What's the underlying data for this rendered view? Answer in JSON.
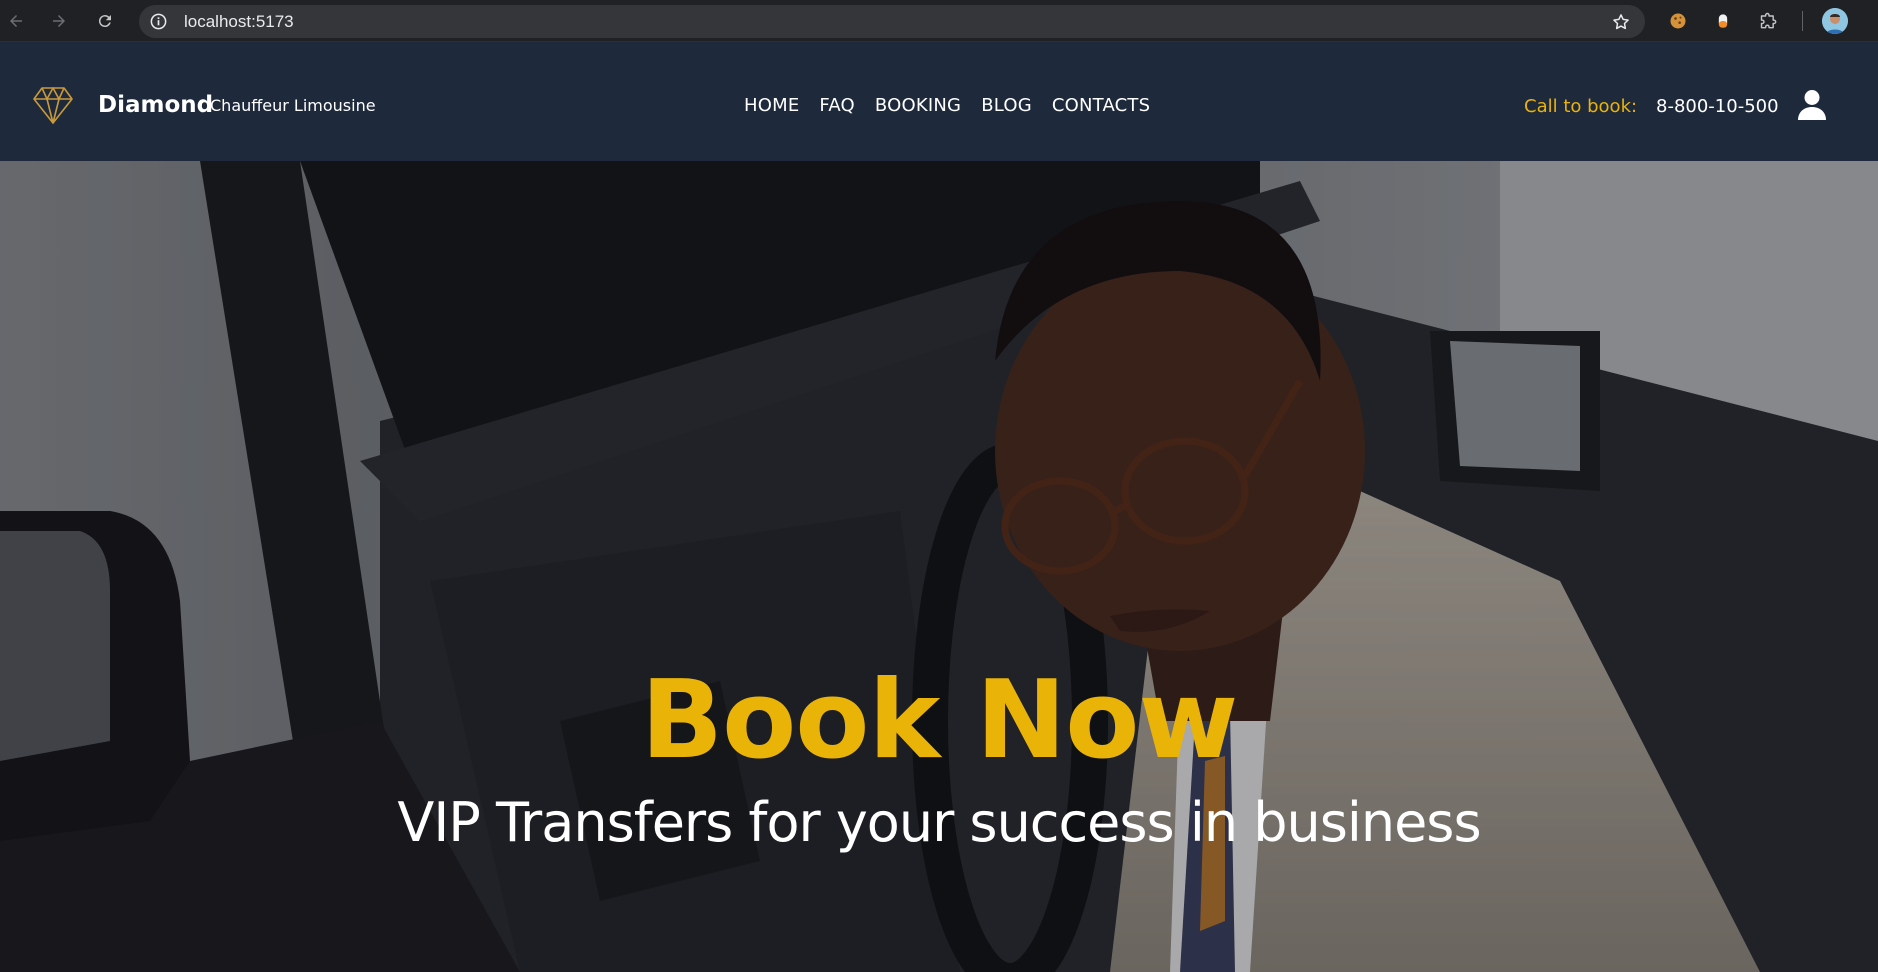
{
  "browser": {
    "url": "localhost:5173"
  },
  "site": {
    "brand": "Diamond",
    "brand_sub": "Chauffeur Limousine",
    "nav": [
      {
        "label": "HOME"
      },
      {
        "label": "FAQ"
      },
      {
        "label": "BOOKING"
      },
      {
        "label": "BLOG"
      },
      {
        "label": "CONTACTS"
      }
    ],
    "call_label": "Call to book:",
    "phone": "8-800-10-500"
  },
  "hero": {
    "title": "Book Now",
    "subtitle": "VIP Transfers for your success in business"
  },
  "colors": {
    "accent": "#eab308",
    "header_bg": "#1e293b",
    "browser_bg": "#202124"
  },
  "icons": {
    "logo": "diamond-icon",
    "user": "user-icon",
    "back": "arrow-left-icon",
    "forward": "arrow-right-icon",
    "reload": "reload-icon",
    "info": "info-icon",
    "bookmark": "star-icon",
    "extensions": "puzzle-icon"
  }
}
